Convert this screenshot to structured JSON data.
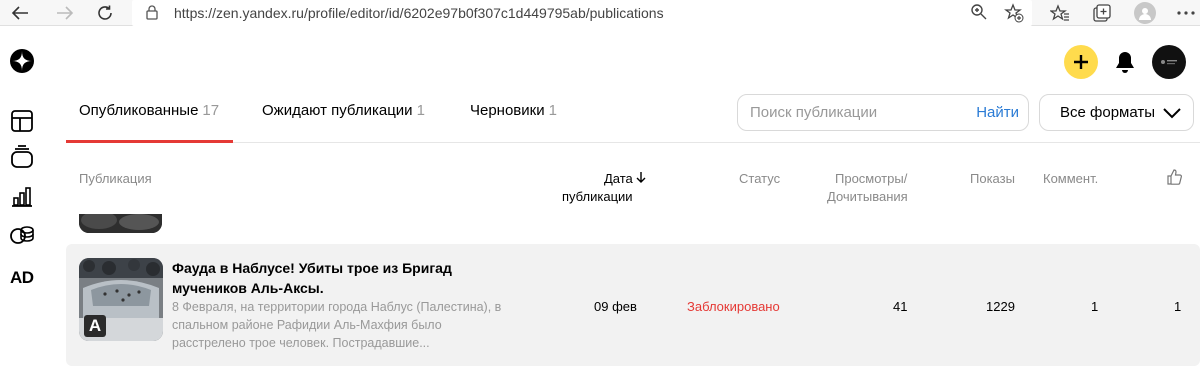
{
  "browser": {
    "url": "https://zen.yandex.ru/profile/editor/id/6202e97b0f307c1d449795ab/publications"
  },
  "tabs": [
    {
      "label": "Опубликованные",
      "count": "17"
    },
    {
      "label": "Ожидают публикации",
      "count": "1"
    },
    {
      "label": "Черновики",
      "count": "1"
    }
  ],
  "search": {
    "placeholder": "Поиск публикации",
    "button": "Найти"
  },
  "formats": {
    "label": "Все форматы"
  },
  "table": {
    "headers": {
      "publication": "Публикация",
      "date_line1": "Дата",
      "date_line2": "публикации",
      "status": "Статус",
      "views_line1": "Просмотры/",
      "views_line2": "Дочитывания",
      "impressions": "Показы",
      "comments": "Коммент."
    },
    "rows": [
      {
        "badge": "A",
        "title": "Фауда в Наблусе! Убиты трое из Бригад мучеников Аль-Аксы.",
        "description": "8 Февраля, на территории города Наблус (Палестина), в спальном районе Рафидии Аль-Махфия было расстрелено трое человек. Пострадавшие...",
        "date": "09 фев",
        "status": "Заблокировано",
        "views": "41",
        "impressions": "1229",
        "comments": "1",
        "likes": "1"
      }
    ]
  },
  "rail": {
    "ad_label": "AD"
  },
  "colors": {
    "accent_yellow": "#ffdb4d",
    "status_red": "#e53935",
    "link_blue": "#2a7bd5"
  }
}
